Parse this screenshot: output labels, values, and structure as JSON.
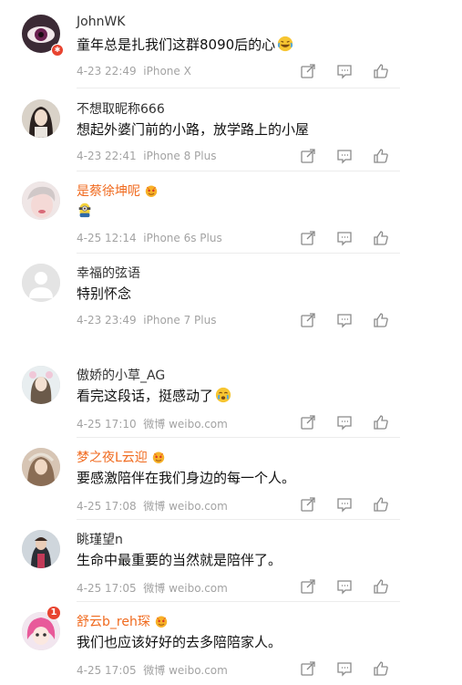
{
  "comments": [
    {
      "user": "JohnWK",
      "text": "童年总是扎我们这群8090后的心",
      "date": "4-23 22:49",
      "source": "iPhone X",
      "vip": false
    },
    {
      "user": "不想取昵称666",
      "text": "想起外婆门前的小路，放学路上的小屋",
      "date": "4-23 22:41",
      "source": "iPhone 8 Plus",
      "vip": false
    },
    {
      "user": "是蔡徐坤呢",
      "text": "",
      "date": "4-25 12:14",
      "source": "iPhone 6s Plus",
      "vip": true
    },
    {
      "user": "幸福的弦语",
      "text": "特别怀念",
      "date": "4-23 23:49",
      "source": "iPhone 7 Plus",
      "vip": false
    },
    {
      "user": "傲娇的小草_AG",
      "text": "看完这段话，挺感动了",
      "date": "4-25 17:10",
      "source": "微博 weibo.com",
      "vip": false
    },
    {
      "user": "梦之夜L云迎",
      "text": "要感激陪伴在我们身边的每一个人。",
      "date": "4-25 17:08",
      "source": "微博 weibo.com",
      "vip": true
    },
    {
      "user": "眺瑾望n",
      "text": "生命中最重要的当然就是陪伴了。",
      "date": "4-25 17:05",
      "source": "微博 weibo.com",
      "vip": false
    },
    {
      "user": "舒云b_reh琛",
      "text": "我们也应该好好的去多陪陪家人。",
      "date": "4-25 17:05",
      "source": "微博 weibo.com",
      "vip": true
    }
  ],
  "badges": {
    "c8_count": "1"
  },
  "colors": {
    "vip_name": "#f06a1e",
    "meta": "#a3a3a3",
    "icon": "#8a8a8a",
    "badge": "#e8432f"
  },
  "icons": [
    "share-icon",
    "comment-icon",
    "like-icon"
  ]
}
